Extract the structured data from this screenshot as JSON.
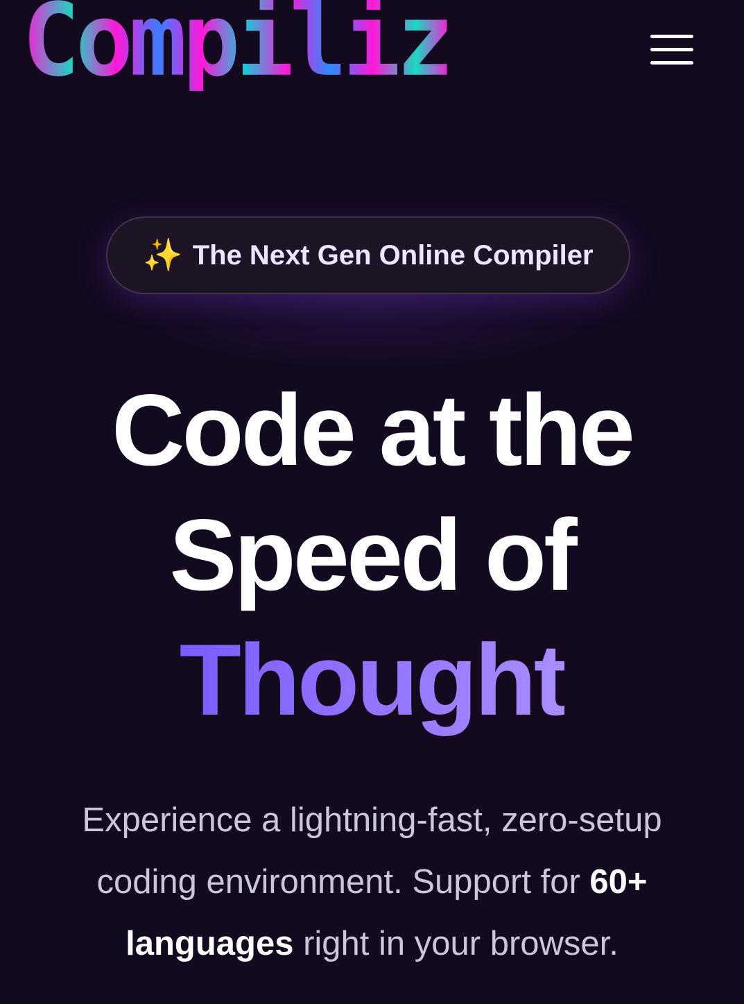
{
  "header": {
    "logo_text": "Compiliz",
    "menu_icon": "hamburger-menu-icon"
  },
  "badge": {
    "icon": "sparkles-icon",
    "icon_glyph": "✨",
    "text": "The Next Gen Online Compiler"
  },
  "hero": {
    "title_line1": "Code at the",
    "title_line2": "Speed of",
    "title_accent": "Thought"
  },
  "subtitle": {
    "part1": "Experience a lightning-fast, zero-setup coding environment. Support for ",
    "highlight1": "60+",
    "space": " ",
    "highlight2": "languages",
    "part2": " right in your browser."
  },
  "colors": {
    "background": "#130a20",
    "accent_start": "#7c5cff",
    "accent_end": "#a98dff",
    "logo_magenta": "#ff18d8",
    "logo_cyan": "#18d8c0",
    "logo_blue": "#3c7cff"
  }
}
